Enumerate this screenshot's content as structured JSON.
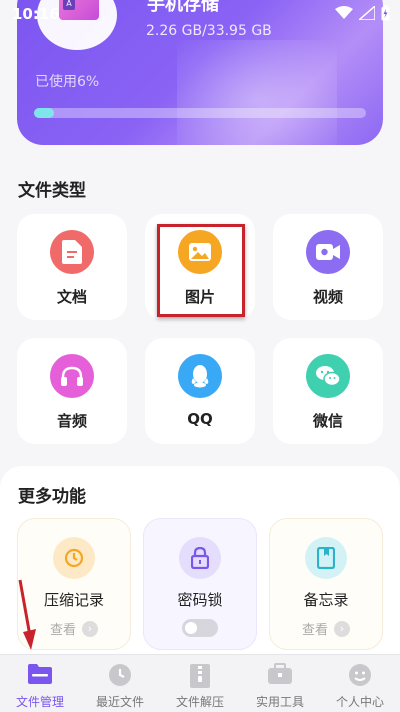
{
  "status_bar": {
    "time": "10:16"
  },
  "storage": {
    "title": "手机存储",
    "size": "2.26 GB/33.95 GB",
    "used_label": "已使用6%",
    "used_percent": 6
  },
  "file_types": {
    "title": "文件类型",
    "items": [
      {
        "label": "文档",
        "icon": "document-icon",
        "color": "#f06a6a"
      },
      {
        "label": "图片",
        "icon": "image-icon",
        "color": "#f5a623"
      },
      {
        "label": "视频",
        "icon": "video-icon",
        "color": "#8c6cf0"
      },
      {
        "label": "音频",
        "icon": "headphones-icon",
        "color": "#e560d8"
      },
      {
        "label": "QQ",
        "icon": "qq-icon",
        "color": "#39a9f5"
      },
      {
        "label": "微信",
        "icon": "wechat-icon",
        "color": "#3fd0b0"
      }
    ]
  },
  "more": {
    "title": "更多功能",
    "cards": [
      {
        "label": "压缩记录",
        "action": "查看",
        "icon": "history-icon"
      },
      {
        "label": "密码锁",
        "icon": "lock-icon",
        "toggle_on": false
      },
      {
        "label": "备忘录",
        "action": "查看",
        "icon": "notebook-icon"
      }
    ]
  },
  "nav": {
    "items": [
      {
        "label": "文件管理",
        "icon": "folder-icon",
        "active": true
      },
      {
        "label": "最近文件",
        "icon": "clock-icon",
        "active": false
      },
      {
        "label": "文件解压",
        "icon": "zip-icon",
        "active": false
      },
      {
        "label": "实用工具",
        "icon": "toolbox-icon",
        "active": false
      },
      {
        "label": "个人中心",
        "icon": "profile-icon",
        "active": false
      }
    ]
  },
  "colors": {
    "accent": "#7a55ef",
    "highlight": "#c8232c"
  }
}
